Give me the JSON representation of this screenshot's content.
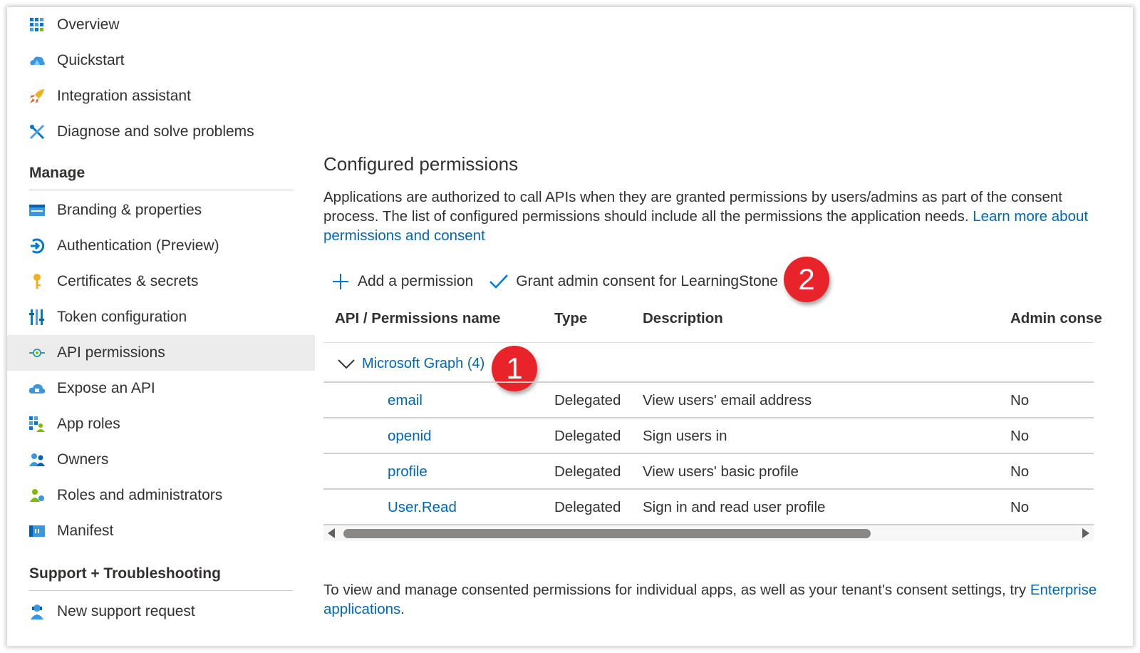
{
  "sidebar": {
    "top_items": [
      {
        "label": "Overview",
        "icon": "overview-icon"
      },
      {
        "label": "Quickstart",
        "icon": "quickstart-icon"
      },
      {
        "label": "Integration assistant",
        "icon": "rocket-icon"
      },
      {
        "label": "Diagnose and solve problems",
        "icon": "wrench-icon"
      }
    ],
    "manage_heading": "Manage",
    "manage_items": [
      {
        "label": "Branding & properties",
        "icon": "branding-icon"
      },
      {
        "label": "Authentication (Preview)",
        "icon": "authentication-icon"
      },
      {
        "label": "Certificates & secrets",
        "icon": "key-icon"
      },
      {
        "label": "Token configuration",
        "icon": "token-icon"
      },
      {
        "label": "API permissions",
        "icon": "api-permissions-icon",
        "active": true
      },
      {
        "label": "Expose an API",
        "icon": "cloud-icon"
      },
      {
        "label": "App roles",
        "icon": "app-roles-icon"
      },
      {
        "label": "Owners",
        "icon": "owners-icon"
      },
      {
        "label": "Roles and administrators",
        "icon": "roles-icon"
      },
      {
        "label": "Manifest",
        "icon": "manifest-icon"
      }
    ],
    "support_heading": "Support + Troubleshooting",
    "support_items": [
      {
        "label": "New support request",
        "icon": "support-icon"
      }
    ]
  },
  "main": {
    "title": "Configured permissions",
    "description": "Applications are authorized to call APIs when they are granted permissions by users/admins as part of the consent process. The list of configured permissions should include all the permissions the application needs. ",
    "description_link": "Learn more about permissions and consent",
    "toolbar": {
      "add_label": "Add a permission",
      "grant_label": "Grant admin consent for LearningStone"
    },
    "callouts": [
      "1",
      "2"
    ],
    "table": {
      "headers": {
        "name": "API / Permissions name",
        "type": "Type",
        "description": "Description",
        "admin": "Admin conse"
      },
      "group": "Microsoft Graph (4)",
      "rows": [
        {
          "name": "email",
          "type": "Delegated",
          "description": "View users' email address",
          "admin": "No"
        },
        {
          "name": "openid",
          "type": "Delegated",
          "description": "Sign users in",
          "admin": "No"
        },
        {
          "name": "profile",
          "type": "Delegated",
          "description": "View users' basic profile",
          "admin": "No"
        },
        {
          "name": "User.Read",
          "type": "Delegated",
          "description": "Sign in and read user profile",
          "admin": "No"
        }
      ]
    },
    "footer_text": "To view and manage consented permissions for individual apps, as well as your tenant's consent settings, try ",
    "footer_link": "Enterprise applications",
    "footer_end": "."
  },
  "colors": {
    "link": "#0067b8",
    "callout": "#e8232a",
    "active_nav": "#ececec"
  }
}
